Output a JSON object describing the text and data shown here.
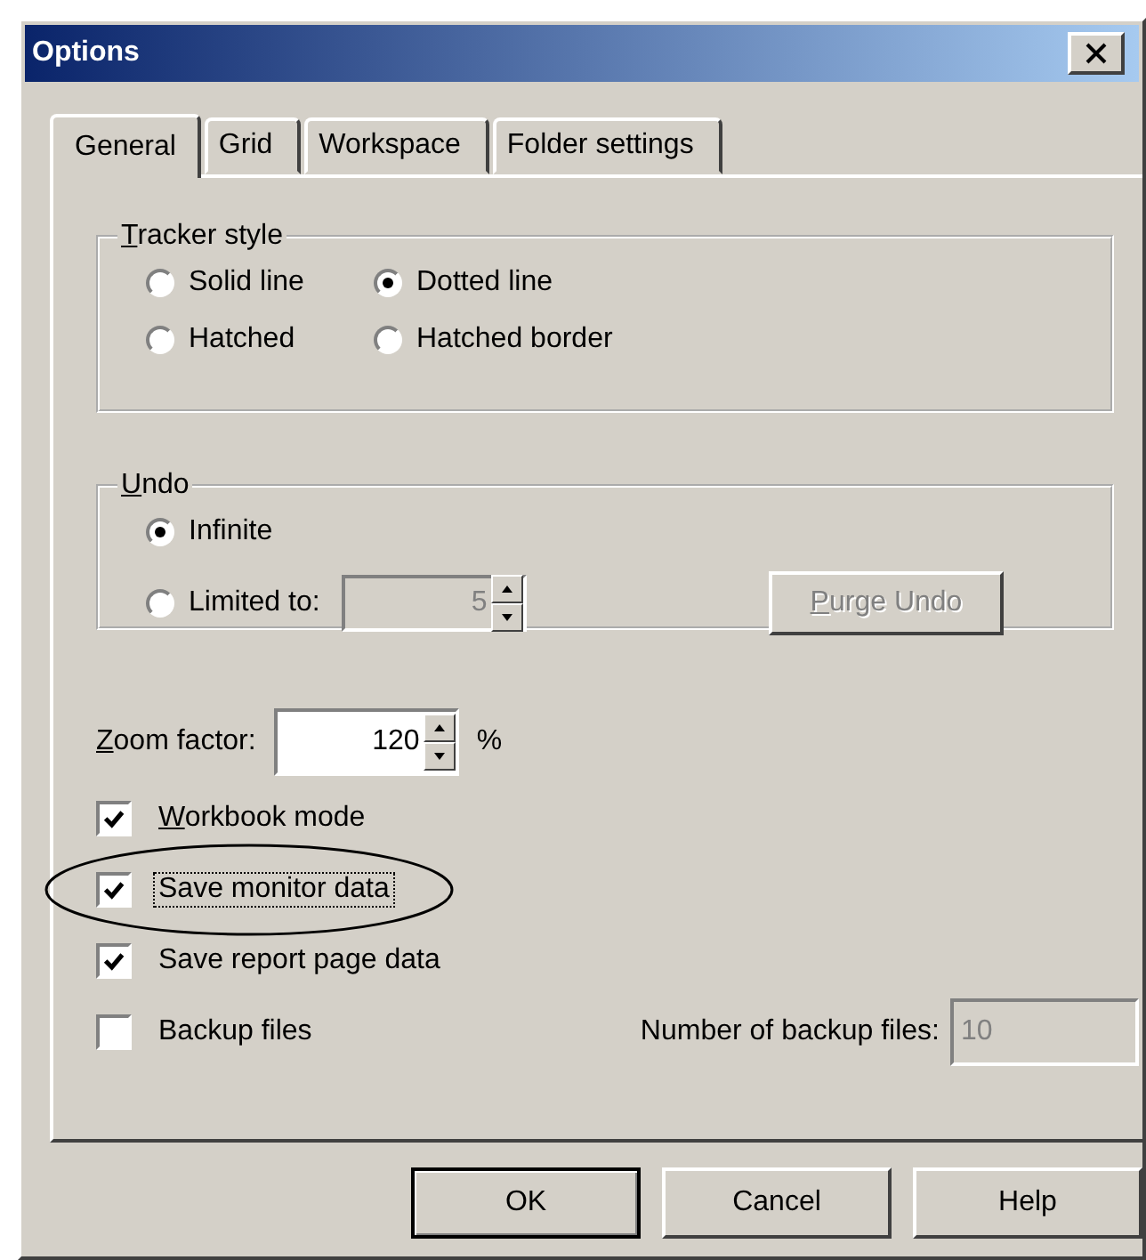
{
  "window": {
    "title": "Options"
  },
  "tabs": [
    {
      "label": "General",
      "selected": true
    },
    {
      "label": "Grid",
      "selected": false
    },
    {
      "label": "Workspace",
      "selected": false
    },
    {
      "label": "Folder settings",
      "selected": false
    }
  ],
  "tracker_style": {
    "label": "Tracker style",
    "mnemonic": true,
    "options": [
      {
        "label": "Solid line",
        "selected": false
      },
      {
        "label": "Dotted line",
        "selected": true
      },
      {
        "label": "Hatched",
        "selected": false
      },
      {
        "label": "Hatched border",
        "selected": false
      }
    ]
  },
  "undo": {
    "label": "Undo",
    "mnemonic": true,
    "options": [
      {
        "label": "Infinite",
        "selected": true
      },
      {
        "label": "Limited to:",
        "selected": false
      }
    ],
    "limit": {
      "value": "5",
      "disabled": true
    },
    "purge_button": {
      "label": "Purge Undo",
      "mnemonic": true,
      "disabled": true
    }
  },
  "zoom": {
    "label": "Zoom factor:",
    "mnemonic": true,
    "value": "120",
    "unit": "%"
  },
  "checkboxes": [
    {
      "label": "Workbook mode",
      "mnemonic": true,
      "checked": true,
      "focused": false,
      "circled": false
    },
    {
      "label": "Save monitor data",
      "mnemonic": false,
      "checked": true,
      "focused": true,
      "circled": true
    },
    {
      "label": "Save report page data",
      "mnemonic": false,
      "checked": true,
      "focused": false,
      "circled": false
    },
    {
      "label": "Backup files",
      "mnemonic": false,
      "checked": false,
      "focused": false,
      "circled": false
    }
  ],
  "backup_count": {
    "label": "Number of backup files:",
    "value": "10",
    "disabled": true
  },
  "buttons": [
    {
      "label": "OK",
      "default": true
    },
    {
      "label": "Cancel",
      "default": false
    },
    {
      "label": "Help",
      "default": false
    }
  ]
}
